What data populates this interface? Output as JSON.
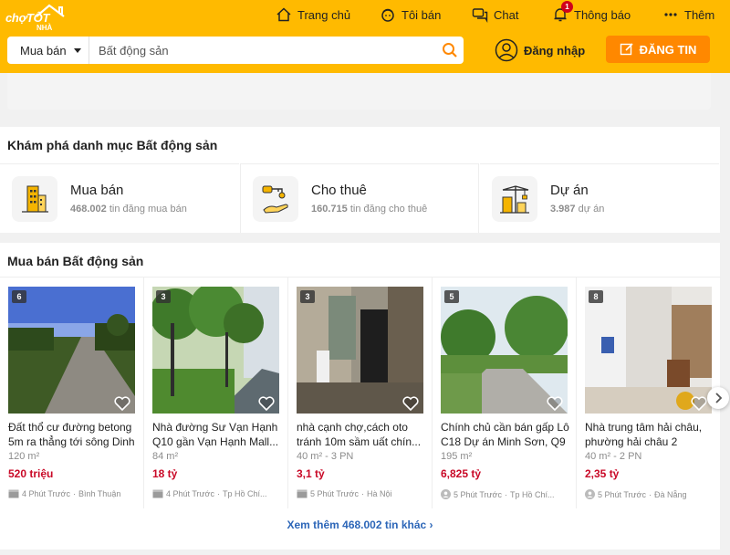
{
  "header": {
    "logo_line1": "chợTỐT",
    "logo_line2": "NHÀ",
    "nav": [
      {
        "label": "Trang chủ",
        "icon": "home-icon"
      },
      {
        "label": "Tôi bán",
        "icon": "seller-icon"
      },
      {
        "label": "Chat",
        "icon": "chat-icon"
      },
      {
        "label": "Thông báo",
        "icon": "bell-icon",
        "badge": "1"
      },
      {
        "label": "Thêm",
        "icon": "more-icon"
      }
    ],
    "search": {
      "category": "Mua bán",
      "placeholder": "Bất động sản"
    },
    "login_label": "Đăng nhập",
    "post_label": "ĐĂNG TIN",
    "accent": "#ffba00",
    "post_color": "#ff8800"
  },
  "categories": {
    "title": "Khám phá danh mục Bất động sản",
    "items": [
      {
        "name": "Mua bán",
        "count": "468.002",
        "suffix": " tin đăng mua bán",
        "icon": "building-icon"
      },
      {
        "name": "Cho thuê",
        "count": "160.715",
        "suffix": " tin đăng cho thuê",
        "icon": "key-hand-icon"
      },
      {
        "name": "Dự án",
        "count": "3.987",
        "suffix": " dự án",
        "icon": "crane-icon"
      }
    ]
  },
  "listings": {
    "title": "Mua bán Bất động sản",
    "items": [
      {
        "photos": "6",
        "title": "Đất thổ cư đường betong 5m ra thẳng tới sông Dinh",
        "meta": "120 m²",
        "price": "520 triệu",
        "time": "4 Phút Trước",
        "location": "Bình Thuận",
        "poster": "shop-icon"
      },
      {
        "photos": "3",
        "title": "Nhà đường Sư Vạn Hạnh Q10 gần Vạn Hạnh Mall...",
        "meta": "84 m²",
        "price": "18 tỷ",
        "time": "4 Phút Trước",
        "location": "Tp Hồ Chí...",
        "poster": "shop-icon"
      },
      {
        "photos": "3",
        "title": "nhà cạnh chợ,cách oto tránh 10m sầm uất chín...",
        "meta": "40 m² - 3 PN",
        "price": "3,1 tỷ",
        "time": "5 Phút Trước",
        "location": "Hà Nội",
        "poster": "shop-icon"
      },
      {
        "photos": "5",
        "title": "Chính chủ cần bán gấp Lô C18 Dự án Minh Sơn, Q9",
        "meta": "195 m²",
        "price": "6,825 tỷ",
        "time": "5 Phút Trước",
        "location": "Tp Hồ Chí...",
        "poster": "user-icon"
      },
      {
        "photos": "8",
        "title": "Nhà trung tâm hải châu, phường hải châu 2",
        "meta": "40 m² - 2 PN",
        "price": "2,35 tỷ",
        "time": "5 Phút Trước",
        "location": "Đà Nẵng",
        "poster": "user-icon"
      }
    ],
    "price_color": "#c90927",
    "more_label": "Xem thêm 468.002 tin khác"
  }
}
